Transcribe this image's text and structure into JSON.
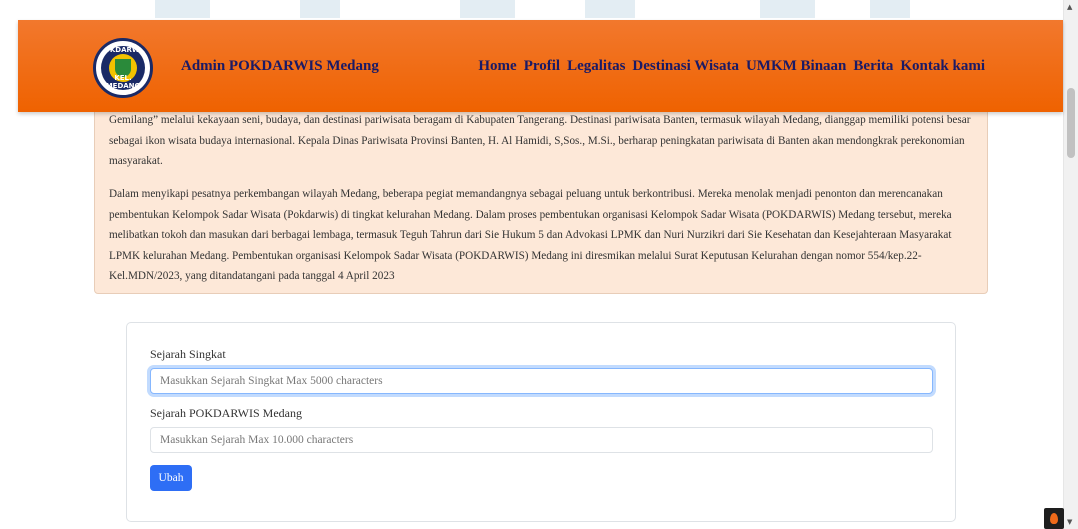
{
  "navbar": {
    "brand": "Admin POKDARWIS Medang",
    "logo": {
      "text_top": "POKDARWIS",
      "text_bottom": "KEL. MEDANG"
    },
    "links": [
      "Home",
      "Profil",
      "Legalitas",
      "Destinasi Wisata",
      "UMKM Binaan",
      "Berita",
      "Kontak kami"
    ]
  },
  "info": {
    "paragraph1": "Gemilang” melalui kekayaan seni, budaya, dan destinasi pariwisata beragam di Kabupaten Tangerang. Destinasi pariwisata Banten, termasuk wilayah Medang, dianggap memiliki potensi besar sebagai ikon wisata budaya internasional. Kepala Dinas Pariwisata Provinsi Banten, H. Al Hamidi, S,Sos., M.Si., berharap peningkatan pariwisata di Banten akan mendongkrak perekonomian masyarakat.",
    "paragraph2": "Dalam menyikapi pesatnya perkembangan wilayah Medang, beberapa pegiat memandangnya sebagai peluang untuk berkontribusi. Mereka menolak menjadi penonton dan merencanakan pembentukan Kelompok Sadar Wisata (Pokdarwis) di tingkat kelurahan Medang. Dalam proses pembentukan organisasi Kelompok Sadar Wisata (POKDARWIS) Medang tersebut, mereka melibatkan tokoh dan masukan dari berbagai lembaga, termasuk Teguh Tahrun dari Sie Hukum 5 dan Advokasi LPMK dan Nuri Nurzikri dari Sie Kesehatan dan Kesejahteraan Masyarakat LPMK kelurahan Medang. Pembentukan organisasi Kelompok Sadar Wisata (POKDARWIS) Medang ini diresmikan melalui Surat Keputusan Kelurahan dengan nomor 554/kep.22-Kel.MDN/2023, yang ditandatangani pada tanggal 4 April 2023"
  },
  "form": {
    "label1": "Sejarah Singkat",
    "placeholder1": "Masukkan Sejarah Singkat Max 5000 characters",
    "label2": "Sejarah POKDARWIS Medang",
    "placeholder2": "Masukkan Sejarah Max 10.000 characters",
    "submit": "Ubah"
  },
  "colors": {
    "navbar": "#ef6200",
    "info_bg": "#fde8d8",
    "button": "#2e6ef5",
    "nav_text": "#1a1a66"
  }
}
